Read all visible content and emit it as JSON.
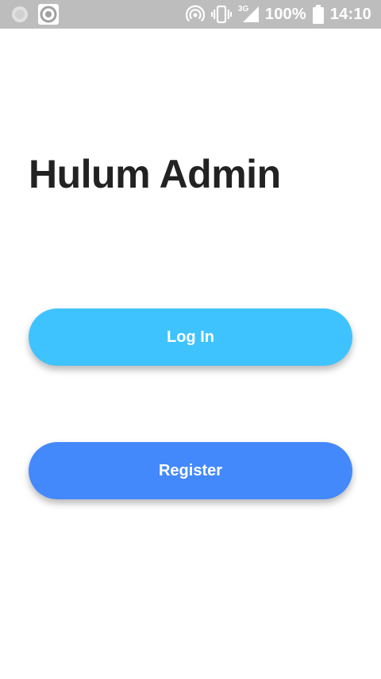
{
  "status_bar": {
    "battery": "100%",
    "time": "14:10",
    "network": "3G",
    "icons": [
      "circle-icon",
      "target-icon",
      "hotspot-icon",
      "vibrate-icon",
      "signal-icon",
      "battery-icon"
    ]
  },
  "app": {
    "title": "Hulum Admin"
  },
  "buttons": {
    "login_label": "Log In",
    "register_label": "Register"
  },
  "colors": {
    "login_button": "#3fc3ff",
    "register_button": "#4489fc",
    "title_text": "#222222",
    "status_bar": "#bdbdbd"
  }
}
